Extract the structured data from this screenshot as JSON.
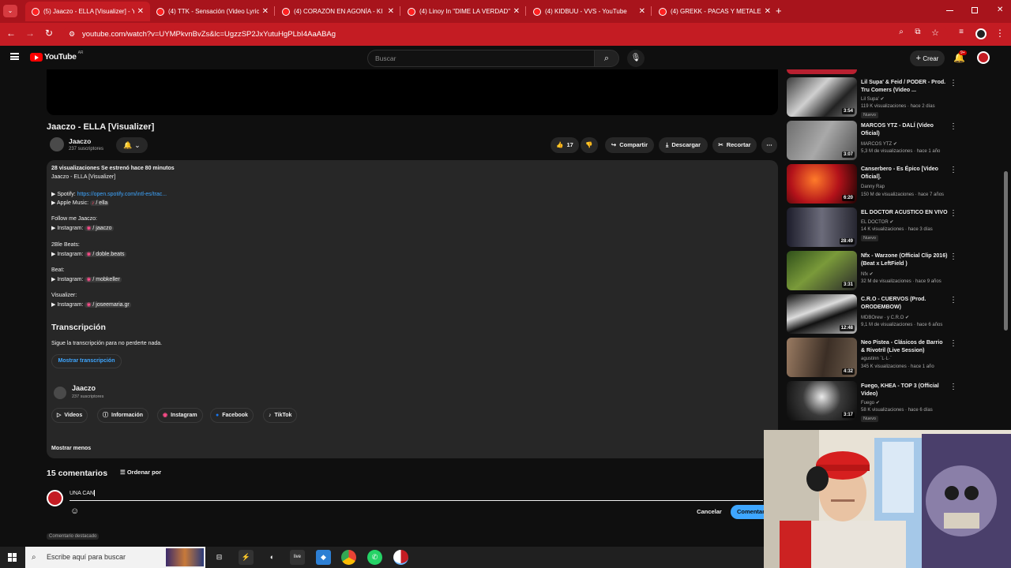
{
  "browser": {
    "tabs": [
      {
        "title": "(5) Jaaczo - ELLA [Visualizer] - Y",
        "active": true
      },
      {
        "title": "(4) TTK - Sensación (Video Lyric",
        "active": false
      },
      {
        "title": "(4) CORAZÓN EN AGONÍA - KI",
        "active": false
      },
      {
        "title": "(4) Linoy In \"DIME LA VERDAD\"",
        "active": false
      },
      {
        "title": "(4) KIDBUU - VVS - YouTube",
        "active": false
      },
      {
        "title": "(4) GREKK - PACAS Y METALES",
        "active": false
      }
    ],
    "close_glyph": "✕",
    "new_tab_glyph": "+",
    "url": "youtube.com/watch?v=UYMPkvnBvZs&lc=UgzzSP2JxYutuHgPLbI4AaABAg"
  },
  "youtube": {
    "logo_text": "YouTube",
    "region": "AR",
    "search_placeholder": "Buscar",
    "create_label": "Crear",
    "notif_count": "9+"
  },
  "video": {
    "title": "Jaaczo - ELLA [Visualizer]",
    "channel": "Jaaczo",
    "subscribers": "237 suscriptores",
    "likes": "17",
    "share": "Compartir",
    "download": "Descargar",
    "clip": "Recortar"
  },
  "description": {
    "stats": "28 visualizaciones  Se estrenó hace 80 minutos",
    "line_title": "Jaaczo - ELLA [Visualizer]",
    "spotify_label": "▶ Spotify:",
    "spotify_link": "https://open.spotify.com/intl-es/trac...",
    "apple_label": "▶ Apple Music:",
    "apple_link": "/ ella",
    "follow": "Follow me Jaaczo:",
    "instagram_label": "▶ Instagram:",
    "instagram_1": "/ jaaczo",
    "beats_title": "2Ble Beats:",
    "instagram_2": "/ doble.beats",
    "beat_title": "Beat:",
    "instagram_3": "/ mobkeller",
    "visualizer_title": "Visualizer:",
    "instagram_4": "/ joseemaria.gr",
    "transcript_title": "Transcripción",
    "transcript_desc": "Sigue la transcripción para no perderte nada.",
    "transcript_button": "Mostrar transcripción",
    "card_channel": "Jaaczo",
    "card_subs": "237 suscriptores",
    "links": [
      "Videos",
      "Información",
      "Instagram",
      "Facebook",
      "TikTok"
    ],
    "show_less": "Mostrar menos"
  },
  "comments": {
    "count": "15 comentarios",
    "sort": "Ordenar por",
    "draft": "UNA CAN",
    "cancel": "Cancelar",
    "submit": "Comentar",
    "pinned": "Comentario destacado"
  },
  "recommendations": [
    {
      "title": "Lil Supa' & Feid / PODER - Prod. Tru Comers (Video ...",
      "channel": "Lil Supa'",
      "meta": "119 K visualizaciones · hace 2 días",
      "duration": "3:54",
      "new": "Nuevo"
    },
    {
      "title": "MARCOS YTZ - DALÍ (Video Oficial)",
      "channel": "MARCOS YTZ",
      "meta": "5,3 M de visualizaciones · hace 1 año",
      "duration": "3:07",
      "new": ""
    },
    {
      "title": "Canserbero - Es Épico [Video Oficial].",
      "channel": "Danny Rap",
      "meta": "150 M de visualizaciones · hace 7 años",
      "duration": "6:20",
      "new": ""
    },
    {
      "title": "EL DOCTOR ACUSTICO EN VIVO",
      "channel": "EL DOCTOR",
      "meta": "14 K visualizaciones · hace 3 días",
      "duration": "28:49",
      "new": "Nuevo"
    },
    {
      "title": "Nfx - Warzone (Official Clip 2016)(Beat x LeftField )",
      "channel": "Nfx",
      "meta": "32 M de visualizaciones · hace 9 años",
      "duration": "3:31",
      "new": ""
    },
    {
      "title": "C.R.O - CUERVOS (Prod. ORODEMBOW)",
      "channel": "MDBOrew · y C.R.O",
      "meta": "9,1 M de visualizaciones · hace 6 años",
      "duration": "12:48",
      "new": ""
    },
    {
      "title": "Neo Pistea - Clásicos de Barrio & Rivotril (Live Session)",
      "channel": "agustinn `L·L·`",
      "meta": "345 K visualizaciones · hace 1 año",
      "duration": "4:32",
      "new": ""
    },
    {
      "title": "Fuego, KHEA - TOP 3 (Official Video)",
      "channel": "Fuego",
      "meta": "58 K visualizaciones · hace 6 días",
      "duration": "3:17",
      "new": "Nuevo"
    }
  ],
  "taskbar": {
    "search_placeholder": "Escribe aquí para buscar"
  },
  "colors": {
    "browser_red": "#c41c23",
    "yt_bg": "#0f0f0f",
    "link_blue": "#3ea6ff"
  }
}
